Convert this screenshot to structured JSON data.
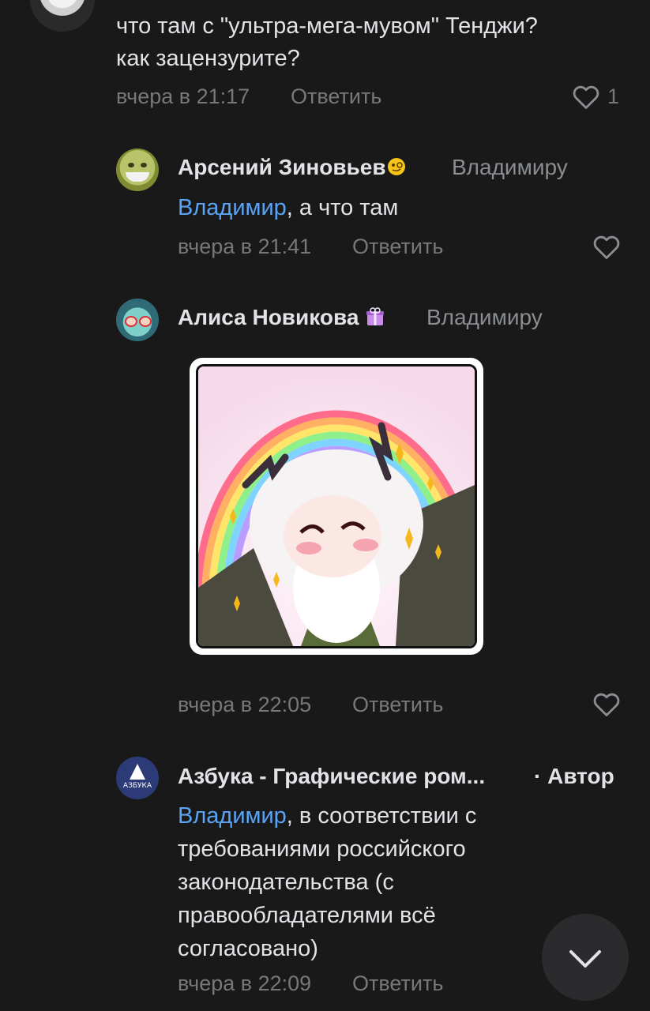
{
  "comments": [
    {
      "text_lines": [
        "что там с \"ультра-мега-мувом\" Тенджи?",
        "как зацензурите?"
      ],
      "time": "вчера в 21:17",
      "reply": "Ответить",
      "likes": "1"
    },
    {
      "author": "Арсений Зиновьев",
      "target": "Владимиру",
      "mention": "Владимир",
      "text_rest": ", а что там",
      "time": "вчера в 21:41",
      "reply": "Ответить"
    },
    {
      "author": "Алиса Новикова",
      "target": "Владимиру",
      "time": "вчера в 22:05",
      "reply": "Ответить"
    },
    {
      "author": "Азбука - Графические ром...",
      "author_tag": "· Автор",
      "avatar_text": "АЗБУКА",
      "mention": "Владимир",
      "text_rest_first": ", в соответствии с",
      "text_lines": [
        "требованиями российского",
        "законодательства (с",
        "правообладателями всё",
        "согласовано)"
      ],
      "time": "вчера в 22:09",
      "reply": "Ответить"
    }
  ],
  "colors": {
    "background": "#19191a",
    "text": "#e1e3e6",
    "muted": "#76787a",
    "mention": "#5aa3f5"
  },
  "icons": {
    "like": "heart-outline-icon",
    "scroll": "chevron-down-icon"
  }
}
